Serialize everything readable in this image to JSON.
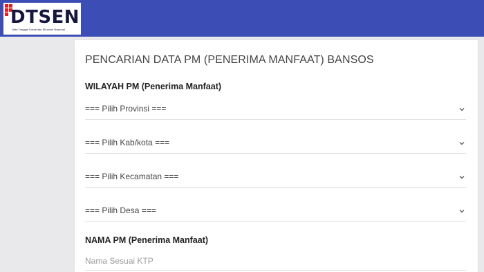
{
  "header": {
    "logo_text": "DTSEN",
    "logo_subtitle": "Data Tunggal Sosial dan Ekonomi Nasional",
    "brand_accent": "#e31e25",
    "bar_color": "#3d4db6"
  },
  "form": {
    "title": "PENCARIAN DATA PM (PENERIMA MANFAAT) BANSOS",
    "wilayah_label": "WILAYAH PM (Penerima Manfaat)",
    "provinsi": "=== Pilih Provinsi ===",
    "kabkota": "=== Pilih Kab/kota ===",
    "kecamatan": "=== Pilih Kecamatan ===",
    "desa": "=== Pilih Desa ===",
    "nama_label": "NAMA PM (Penerima Manfaat)",
    "nama_placeholder": "Nama Sesuai KTP"
  }
}
